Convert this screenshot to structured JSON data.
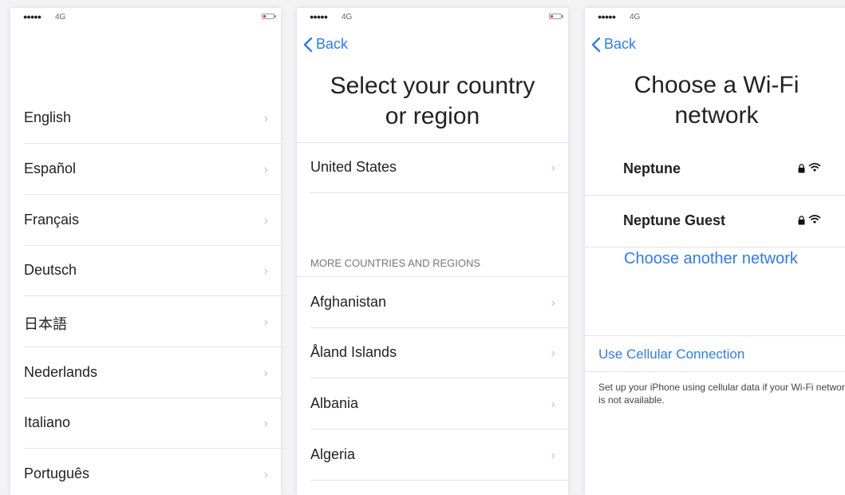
{
  "status": {
    "signal_dots": "●●●●●",
    "network": "4G"
  },
  "colors": {
    "accent": "#2d7bf2",
    "battery_low": "#e03a30"
  },
  "language_screen": {
    "languages": [
      "English",
      "Español",
      "Français",
      "Deutsch",
      "日本語",
      "Nederlands",
      "Italiano",
      "Português"
    ]
  },
  "country_screen": {
    "back_label": "Back",
    "title_line1": "Select your country",
    "title_line2": "or region",
    "suggested": "United States",
    "section_header": "MORE COUNTRIES AND REGIONS",
    "countries": [
      "Afghanistan",
      "Åland Islands",
      "Albania",
      "Algeria"
    ]
  },
  "wifi_screen": {
    "back_label": "Back",
    "title_line1": "Choose a Wi-Fi",
    "title_line2": "network",
    "networks": [
      "Neptune",
      "Neptune Guest"
    ],
    "other_network": "Choose another network",
    "cellular_link": "Use Cellular Connection",
    "cellular_note": "Set up your iPhone using cellular data if your Wi-Fi network is not available."
  },
  "icons": {
    "back": "chevron-left-icon",
    "row": "chevron-right-icon",
    "lock": "lock-icon",
    "wifi": "wifi-icon",
    "battery": "battery-icon"
  }
}
